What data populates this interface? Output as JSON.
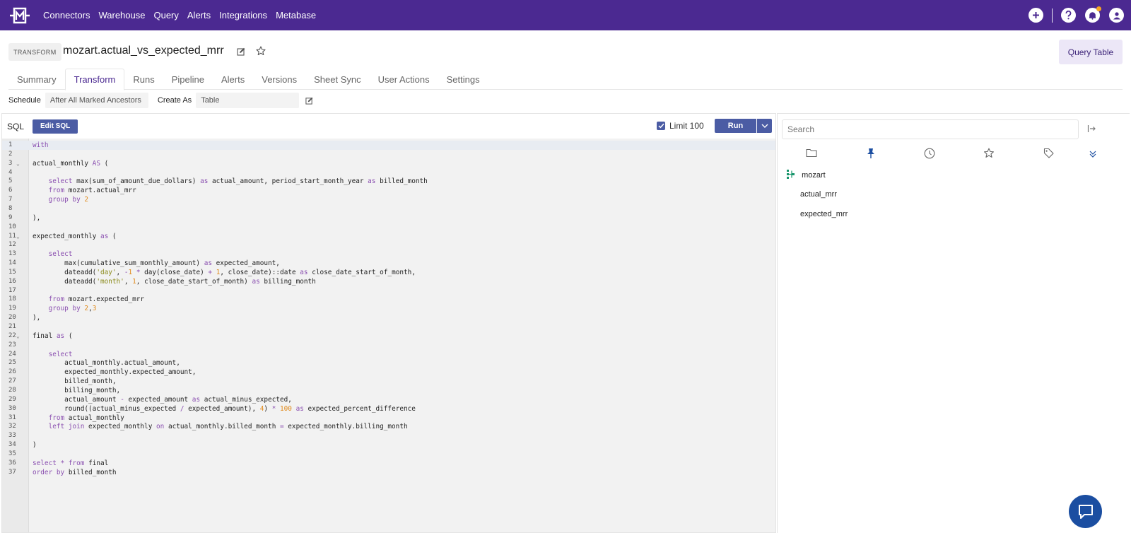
{
  "nav": {
    "links": [
      "Connectors",
      "Warehouse",
      "Query",
      "Alerts",
      "Integrations",
      "Metabase"
    ],
    "icons": [
      "plus-icon",
      "help-icon",
      "bell-icon",
      "user-icon"
    ],
    "brand_color": "#4b2991",
    "notification_dot_color": "#f5a623"
  },
  "header": {
    "type_badge": "TRANSFORM",
    "title": "mozart.actual_vs_expected_mrr",
    "query_table_label": "Query Table"
  },
  "tabs": [
    {
      "label": "Summary",
      "active": false
    },
    {
      "label": "Transform",
      "active": true
    },
    {
      "label": "Runs",
      "active": false
    },
    {
      "label": "Pipeline",
      "active": false
    },
    {
      "label": "Alerts",
      "active": false
    },
    {
      "label": "Versions",
      "active": false
    },
    {
      "label": "Sheet Sync",
      "active": false
    },
    {
      "label": "User Actions",
      "active": false
    },
    {
      "label": "Settings",
      "active": false
    }
  ],
  "schedule": {
    "schedule_label": "Schedule",
    "schedule_value": "After All Marked Ancestors",
    "create_as_label": "Create As",
    "create_as_value": "Table"
  },
  "editor": {
    "sql_label": "SQL",
    "edit_sql_label": "Edit SQL",
    "limit_label": "Limit 100",
    "limit_checked": true,
    "run_label": "Run",
    "button_color": "#4b5ca4",
    "code_lines": [
      "with",
      "",
      "actual_monthly AS (",
      "",
      "    select max(sum_of_amount_due_dollars) as actual_amount, period_start_month_year as billed_month",
      "    from mozart.actual_mrr",
      "    group by 2",
      "",
      "),",
      "",
      "expected_monthly as (",
      "",
      "    select",
      "        max(cumulative_sum_monthly_amount) as expected_amount,",
      "        dateadd('day', -1 * day(close_date) + 1, close_date)::date as close_date_start_of_month,",
      "        dateadd('month', 1, close_date_start_of_month) as billing_month",
      "",
      "    from mozart.expected_mrr",
      "    group by 2,3",
      "),",
      "",
      "final as (",
      "",
      "    select",
      "        actual_monthly.actual_amount,",
      "        expected_monthly.expected_amount,",
      "        billed_month,",
      "        billing_month,",
      "        actual_amount - expected_amount as actual_minus_expected,",
      "        round((actual_minus_expected / expected_amount), 4) * 100 as expected_percent_difference",
      "    from actual_monthly",
      "    left join expected_monthly on actual_monthly.billed_month = expected_monthly.billing_month",
      "",
      ")",
      "",
      "select * from final",
      "order by billed_month"
    ],
    "fold_lines": [
      3,
      11,
      22
    ]
  },
  "sidebar": {
    "search_placeholder": "Search",
    "tab_icons": [
      "folder-icon",
      "pin-icon",
      "clock-icon",
      "star-icon",
      "tag-icon"
    ],
    "active_tab_color": "#1b4ea1",
    "tree": [
      {
        "label": "mozart",
        "level": 0
      },
      {
        "label": "actual_mrr",
        "level": 1
      },
      {
        "label": "expected_mrr",
        "level": 1
      }
    ]
  },
  "chat": {
    "color": "#1b4ea1"
  }
}
